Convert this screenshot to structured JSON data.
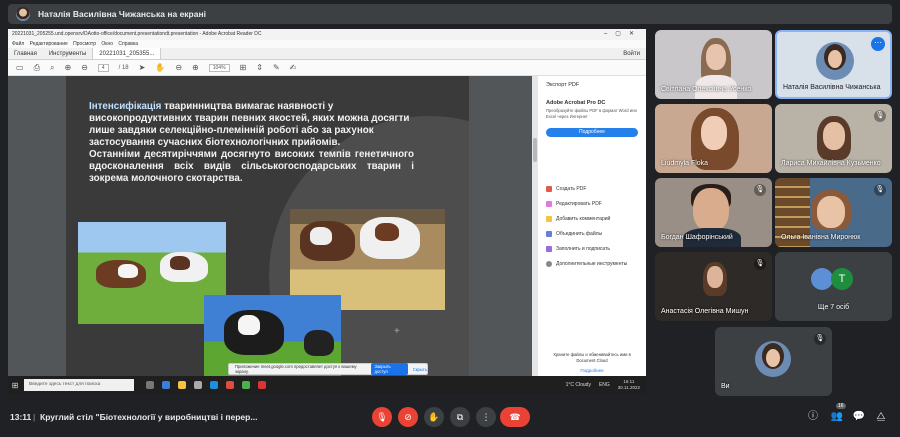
{
  "presenter_banner": {
    "text": "Наталія Василівна Чижанська на екрані"
  },
  "screen": {
    "window_title": "20221031_205255.und.opensrv/DAotto-office/document.presentationdt.presentation - Adobe Acrobat Reader DC",
    "menu": "Файл   Редактирование   Просмотр   Окно   Справка",
    "tabs": {
      "home": "Главная",
      "tools": "Инструменты",
      "doc": "20221031_205355...",
      "login": "Войти"
    },
    "toolbar": {
      "page": "4",
      "of": "/ 18",
      "zoom": "104%"
    },
    "slide": {
      "bold_word": "Інтенсифікація",
      "para1_rest": " тваринництва вимагає наявності у високопродуктивних тварин певних якостей, яких можна досягти лише завдяки селекційно-племінній роботі або за рахунок застосування сучасних біотехнологічних прийомів.",
      "para2": "Останніми десятиріччями досягнуто високих темпів генетичного вдосконалення всіх видів сільськогосподарських тварин і зокрема молочного скотарства."
    },
    "side_panel": {
      "export": "Экспорт PDF",
      "acrobat": "Adobe Acrobat Pro DC",
      "desc": "Преобразуйте файлы PDF в формат Word или Excel через Интернет",
      "button": "Подробнее",
      "items": [
        "Создать PDF",
        "Редактировать PDF",
        "Добавить комментарий",
        "Объединить файлы",
        "Заполнить и подписать",
        "Дополнительные инструменты"
      ],
      "cloud_text": "Храните файлы и обменивайтесь ими в Document Cloud",
      "more": "Подробнее"
    },
    "notification": {
      "text": "Приложение meet.google.com предоставляет доступ к вашему экрану.",
      "stop": "Закрыть доступ",
      "hide": "Скрыть"
    },
    "taskbar": {
      "search": "Введите здесь текст для поиска",
      "weather": "1°C  Cloudy",
      "lang": "ENG",
      "time": "16:11",
      "date": "30.11.2022"
    }
  },
  "participants": [
    {
      "name": "Світлана Олексіївна Усенко",
      "muted": false
    },
    {
      "name": "Наталія Василівна Чижанська",
      "muted": false,
      "active": true
    },
    {
      "name": "Liudmyla Floka",
      "muted": false
    },
    {
      "name": "Лариса Михайлівна Кузьменко",
      "muted": true
    },
    {
      "name": "Богдан Шафорінський",
      "muted": true
    },
    {
      "name": "Ольга Іванівна Миронюк",
      "muted": true
    },
    {
      "name": "Анастасія Олегівна Мишун",
      "muted": true
    },
    {
      "name": "Ще 7 осіб",
      "avatar_letter": "T"
    },
    {
      "name": "Ви",
      "muted": true
    }
  ],
  "meet_bar": {
    "time": "13:11",
    "separator": "|",
    "title": "Круглий стіл \"Біотехнології у виробництві і перер...",
    "participant_count": "16"
  },
  "colors": {
    "accent": "#8ab4f8",
    "red": "#ea4335",
    "bg": "#202124",
    "tile": "#3c4043"
  }
}
